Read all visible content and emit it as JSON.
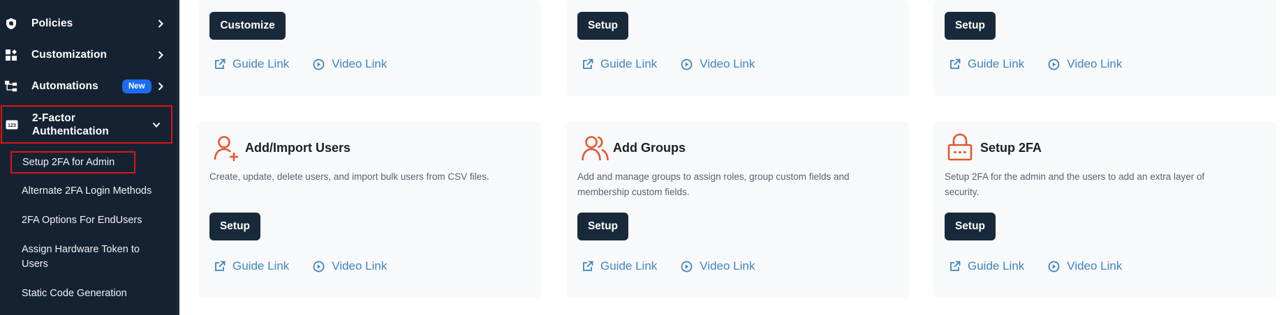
{
  "sidebar": {
    "items": [
      {
        "label": "Policies",
        "icon": "shield-icon"
      },
      {
        "label": "Customization",
        "icon": "widgets-icon"
      },
      {
        "label": "Automations",
        "icon": "workflow-icon",
        "badge": "New"
      },
      {
        "label_line1": "2-Factor",
        "label_line2": "Authentication",
        "icon": "2fa-123-icon"
      }
    ],
    "subitems": [
      "Setup 2FA for Admin",
      "Alternate 2FA Login Methods",
      "2FA Options For EndUsers",
      "Assign Hardware Token to",
      "Users",
      "Static Code Generation"
    ]
  },
  "cards_top": [
    {
      "button": "Customize",
      "guide": "Guide Link",
      "video": "Video Link"
    },
    {
      "button": "Setup",
      "guide": "Guide Link",
      "video": "Video Link"
    },
    {
      "button": "Setup",
      "guide": "Guide Link",
      "video": "Video Link"
    }
  ],
  "cards_bottom": [
    {
      "title": "Add/Import Users",
      "desc_line1": "Create, update, delete users, and import bulk users from CSV files.",
      "desc_line2": "",
      "button": "Setup",
      "guide": "Guide Link",
      "video": "Video Link",
      "icon": "add-user-icon"
    },
    {
      "title": "Add Groups",
      "desc_line1": "Add and manage groups to assign roles, group custom fields and",
      "desc_line2": "membership custom fields.",
      "button": "Setup",
      "guide": "Guide Link",
      "video": "Video Link",
      "icon": "group-icon"
    },
    {
      "title": "Setup 2FA",
      "desc_line1": "Setup 2FA for the admin and the users to add an extra layer of",
      "desc_line2": "security.",
      "button": "Setup",
      "guide": "Guide Link",
      "video": "Video Link",
      "icon": "lock-icon"
    }
  ],
  "colors": {
    "sidebar": "#152232",
    "accent_orange": "#e4562c",
    "link_blue": "#3d85bd",
    "button_dark": "#17293a",
    "highlight_red": "#e01414"
  }
}
